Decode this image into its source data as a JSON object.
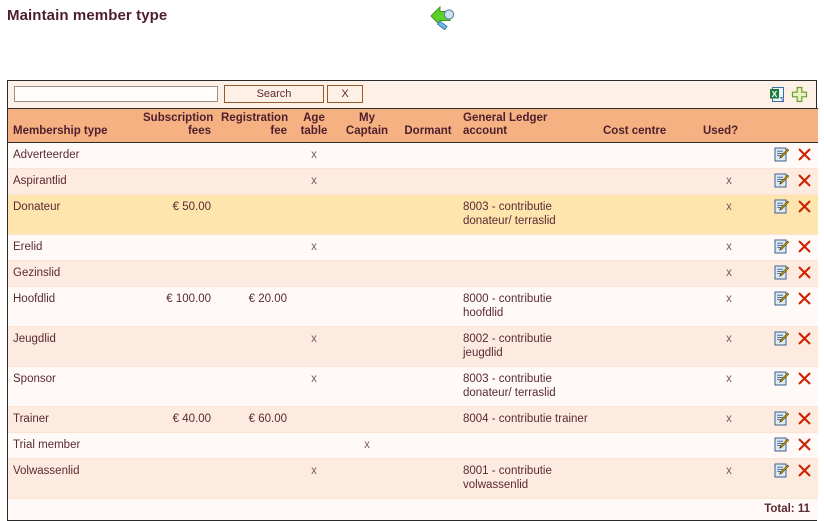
{
  "page": {
    "title": "Maintain member type",
    "back_icon": "back-arrow-icon"
  },
  "toolbar": {
    "search_value": "",
    "search_placeholder": "",
    "search_label": "Search",
    "clear_label": "X",
    "excel_icon": "excel-export-icon",
    "add_icon": "add-new-icon"
  },
  "colors": {
    "header_background": "#f6b183",
    "selected_row": "#fde5ad",
    "row_odd": "#fffaf7",
    "row_even": "#fdebe0",
    "text": "#5a2a33",
    "border": "#2b2b2b",
    "delete_icon": "#cc2200",
    "add_icon": "#7ab648",
    "excel_icon": "#1f7a3d"
  },
  "grid": {
    "columns": [
      {
        "key": "name",
        "label": "Membership type",
        "align": "left"
      },
      {
        "key": "sub",
        "label": "Subscription fees",
        "align": "right"
      },
      {
        "key": "reg",
        "label": "Registration fee",
        "align": "right"
      },
      {
        "key": "age",
        "label": "Age table",
        "align": "center"
      },
      {
        "key": "captain",
        "label": "My Captain",
        "align": "center"
      },
      {
        "key": "dormant",
        "label": "Dormant",
        "align": "center"
      },
      {
        "key": "gl",
        "label": "General Ledger account",
        "align": "left"
      },
      {
        "key": "cost",
        "label": "Cost centre",
        "align": "left"
      },
      {
        "key": "used",
        "label": "Used?",
        "align": "center"
      },
      {
        "key": "actions",
        "label": "",
        "align": "right"
      }
    ],
    "rows": [
      {
        "name": "Adverteerder",
        "sub": "",
        "reg": "",
        "age": "x",
        "captain": "",
        "dormant": "",
        "gl": "",
        "cost": "",
        "used": "",
        "style": "row-odd"
      },
      {
        "name": "Aspirantlid",
        "sub": "",
        "reg": "",
        "age": "x",
        "captain": "",
        "dormant": "",
        "gl": "",
        "cost": "",
        "used": "x",
        "style": "row-even"
      },
      {
        "name": "Donateur",
        "sub": "€ 50.00",
        "reg": "",
        "age": "",
        "captain": "",
        "dormant": "",
        "gl": "8003 - contributie donateur/ terraslid",
        "cost": "",
        "used": "x",
        "style": "row-sel"
      },
      {
        "name": "Erelid",
        "sub": "",
        "reg": "",
        "age": "x",
        "captain": "",
        "dormant": "",
        "gl": "",
        "cost": "",
        "used": "x",
        "style": "row-odd"
      },
      {
        "name": "Gezinslid",
        "sub": "",
        "reg": "",
        "age": "",
        "captain": "",
        "dormant": "",
        "gl": "",
        "cost": "",
        "used": "x",
        "style": "row-even"
      },
      {
        "name": "Hoofdlid",
        "sub": "€ 100.00",
        "reg": "€ 20.00",
        "age": "",
        "captain": "",
        "dormant": "",
        "gl": "8000 - contributie hoofdlid",
        "cost": "",
        "used": "x",
        "style": "row-odd"
      },
      {
        "name": "Jeugdlid",
        "sub": "",
        "reg": "",
        "age": "x",
        "captain": "",
        "dormant": "",
        "gl": "8002 - contributie jeugdlid",
        "cost": "",
        "used": "x",
        "style": "row-even"
      },
      {
        "name": "Sponsor",
        "sub": "",
        "reg": "",
        "age": "x",
        "captain": "",
        "dormant": "",
        "gl": "8003 - contributie donateur/ terraslid",
        "cost": "",
        "used": "x",
        "style": "row-odd"
      },
      {
        "name": "Trainer",
        "sub": "€ 40.00",
        "reg": "€ 60.00",
        "age": "",
        "captain": "",
        "dormant": "",
        "gl": "8004 - contributie trainer",
        "cost": "",
        "used": "x",
        "style": "row-even"
      },
      {
        "name": "Trial member",
        "sub": "",
        "reg": "",
        "age": "",
        "captain": "x",
        "dormant": "",
        "gl": "",
        "cost": "",
        "used": "",
        "style": "row-odd"
      },
      {
        "name": "Volwassenlid",
        "sub": "",
        "reg": "",
        "age": "x",
        "captain": "",
        "dormant": "",
        "gl": "8001 - contributie volwassenlid",
        "cost": "",
        "used": "x",
        "style": "row-even"
      }
    ],
    "row_actions": {
      "edit_icon": "edit-icon",
      "delete_icon": "delete-icon"
    },
    "footer": {
      "total_label": "Total: 11"
    }
  }
}
